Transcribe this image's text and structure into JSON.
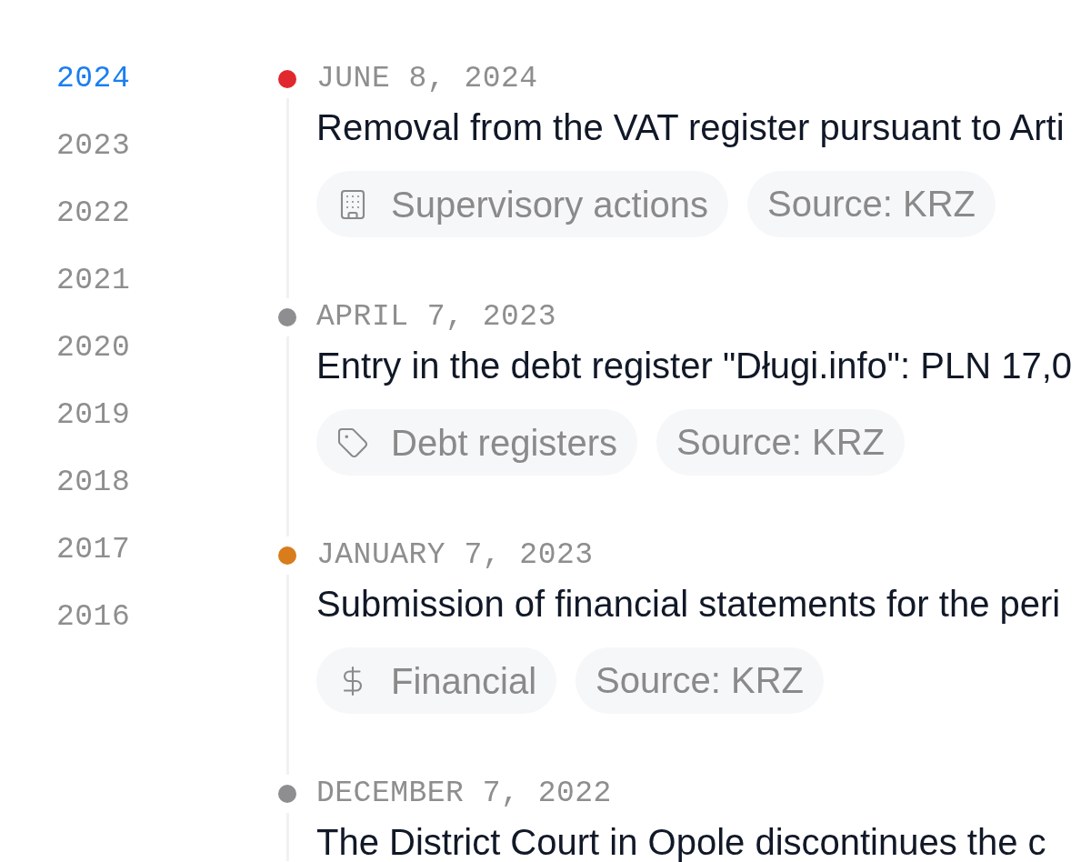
{
  "years": [
    {
      "label": "2024",
      "selected": true
    },
    {
      "label": "2023",
      "selected": false
    },
    {
      "label": "2022",
      "selected": false
    },
    {
      "label": "2021",
      "selected": false
    },
    {
      "label": "2020",
      "selected": false
    },
    {
      "label": "2019",
      "selected": false
    },
    {
      "label": "2018",
      "selected": false
    },
    {
      "label": "2017",
      "selected": false
    },
    {
      "label": "2016",
      "selected": false
    }
  ],
  "entries": [
    {
      "date": "JUNE 8, 2024",
      "color": "#e0282e",
      "title": "Removal from the VAT register pursuant to Arti",
      "tags": [
        {
          "kind": "supervisory",
          "label": "Supervisory actions"
        },
        {
          "kind": "source",
          "label": "Source: KRZ"
        }
      ]
    },
    {
      "date": "APRIL 7, 2023",
      "color": "#8e8e90",
      "title": "Entry in the debt register \"Długi.info\": PLN 17,0",
      "tags": [
        {
          "kind": "debt",
          "label": "Debt registers"
        },
        {
          "kind": "source",
          "label": "Source: KRZ"
        }
      ]
    },
    {
      "date": "JANUARY 7, 2023",
      "color": "#d97c1b",
      "title": "Submission of financial statements for the peri",
      "tags": [
        {
          "kind": "financial",
          "label": "Financial"
        },
        {
          "kind": "source",
          "label": "Source: KRZ"
        }
      ]
    },
    {
      "date": "DECEMBER 7, 2022",
      "color": "#8e8e90",
      "title": "The District Court in Opole discontinues the c"
    }
  ]
}
